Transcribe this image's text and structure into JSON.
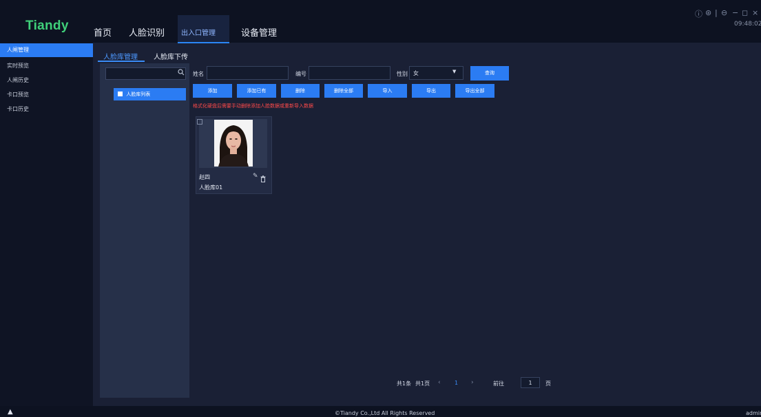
{
  "app": {
    "logo": "Tiandy",
    "time": "09:48:02"
  },
  "nav": {
    "items": [
      {
        "label": "首页"
      },
      {
        "label": "人脸识别"
      },
      {
        "label": "出入口管理"
      },
      {
        "label": "设备管理"
      }
    ]
  },
  "sidebar": {
    "items": [
      {
        "label": "人闸管理"
      },
      {
        "label": "实时预览"
      },
      {
        "label": "人闸历史"
      },
      {
        "label": "卡口预览"
      },
      {
        "label": "卡口历史"
      }
    ]
  },
  "tabs": [
    {
      "label": "人脸库管理"
    },
    {
      "label": "人脸库下传"
    }
  ],
  "tree": {
    "item_label": "人脸库列表"
  },
  "filter": {
    "name_label": "姓名",
    "name_value": "",
    "id_label": "编号",
    "id_value": "",
    "gender_label": "性别",
    "gender_value": "女",
    "query_label": "查询"
  },
  "toolbar": {
    "add": "添加",
    "add_existing": "添加已有",
    "delete": "删除",
    "delete_all": "删除全部",
    "import": "导入",
    "export": "导出",
    "export_all": "导出全部"
  },
  "warning": "格式化硬盘后需要手动删除添加人脸数据或重新导入数据",
  "card": {
    "name": "赵四",
    "library": "人脸库01"
  },
  "pager": {
    "total_items": "共1条",
    "total_pages": "共1页",
    "current_page": "1",
    "goto_label": "前往",
    "goto_value": "1",
    "page_unit": "页"
  },
  "footer": {
    "copyright": "©Tiandy Co.,Ltd All Rights Reserved",
    "user": "admin"
  },
  "icons": {
    "search": "search-icon",
    "tree_item": "face-library-icon",
    "edit": "edit-icon",
    "delete": "trash-icon",
    "dropdown": "caret-down-icon",
    "warning": "warning-icon"
  },
  "colors": {
    "accent": "#2b7cf3",
    "logo": "#3fd07a",
    "warning_text": "#ff4a4a",
    "background": "#1a2035"
  }
}
